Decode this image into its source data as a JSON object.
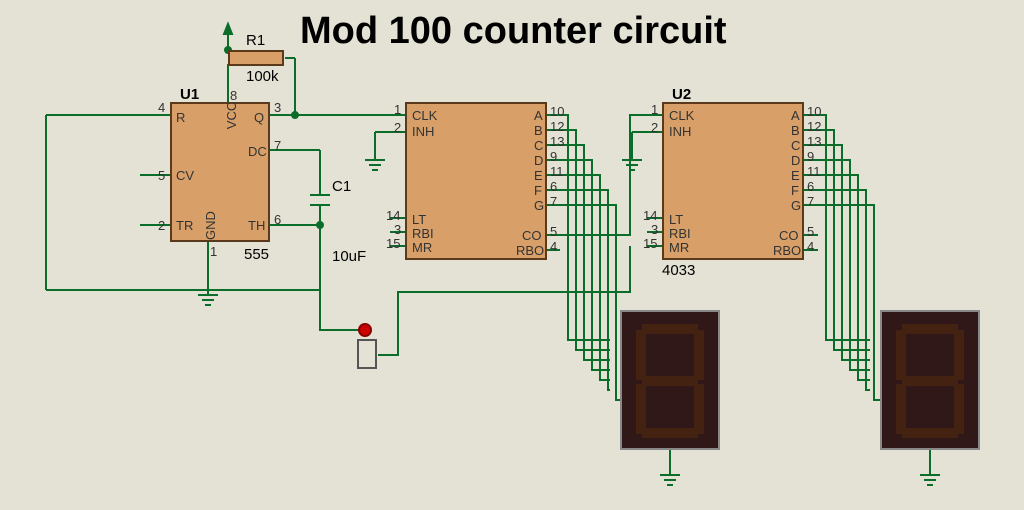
{
  "title": "Mod 100 counter circuit",
  "components": {
    "U1": {
      "ref": "U1",
      "type": "555",
      "pins_left": [
        [
          "4",
          "R"
        ],
        [
          "5",
          "CV"
        ],
        [
          "2",
          "TR"
        ]
      ],
      "pins_top": [
        [
          "8",
          "VCC"
        ]
      ],
      "pins_bottom": [
        [
          "1",
          "GND"
        ]
      ],
      "pins_right": [
        [
          "3",
          "Q"
        ],
        [
          "7",
          "DC"
        ],
        [
          "6",
          "TH"
        ]
      ]
    },
    "R1": {
      "ref": "R1",
      "value": "100k"
    },
    "C1": {
      "ref": "C1",
      "value": "10uF"
    },
    "IC1": {
      "pins_left": [
        [
          "1",
          "CLK"
        ],
        [
          "2",
          "INH"
        ],
        [
          "14",
          "LT"
        ],
        [
          "3",
          "RBI"
        ],
        [
          "15",
          "MR"
        ]
      ],
      "pins_right": [
        [
          "10",
          "A"
        ],
        [
          "12",
          "B"
        ],
        [
          "13",
          "C"
        ],
        [
          "9",
          "D"
        ],
        [
          "11",
          "E"
        ],
        [
          "6",
          "F"
        ],
        [
          "7",
          "G"
        ],
        [
          "5",
          "CO"
        ],
        [
          "4",
          "RBO"
        ]
      ]
    },
    "U2": {
      "ref": "U2",
      "type": "4033",
      "pins_left": [
        [
          "1",
          "CLK"
        ],
        [
          "2",
          "INH"
        ],
        [
          "14",
          "LT"
        ],
        [
          "3",
          "RBI"
        ],
        [
          "15",
          "MR"
        ]
      ],
      "pins_right": [
        [
          "10",
          "A"
        ],
        [
          "12",
          "B"
        ],
        [
          "13",
          "C"
        ],
        [
          "9",
          "D"
        ],
        [
          "11",
          "E"
        ],
        [
          "6",
          "F"
        ],
        [
          "7",
          "G"
        ],
        [
          "5",
          "CO"
        ],
        [
          "4",
          "RBO"
        ]
      ]
    }
  }
}
